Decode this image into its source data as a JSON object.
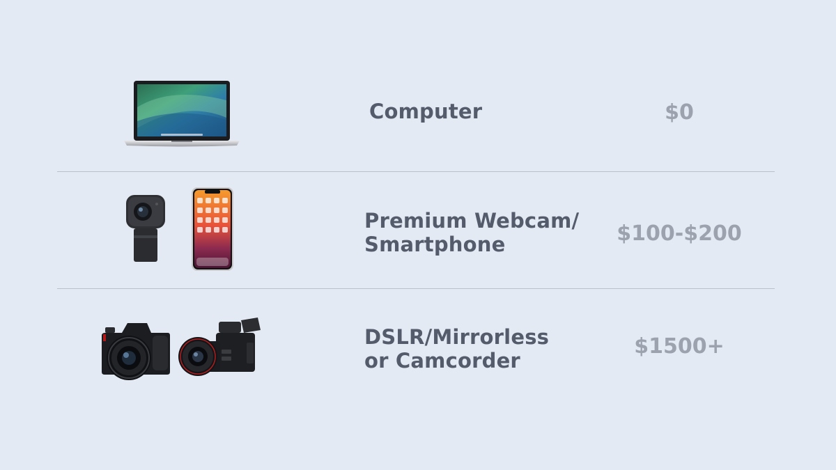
{
  "rows": [
    {
      "id": "computer",
      "label_lines": [
        "Computer"
      ],
      "price": "$0",
      "icon": "laptop-icon"
    },
    {
      "id": "webcam-smartphone",
      "label_lines": [
        "Premium Webcam/",
        "Smartphone"
      ],
      "price": "$100-$200",
      "icons": [
        "webcam-icon",
        "smartphone-icon"
      ]
    },
    {
      "id": "dslr-camcorder",
      "label_lines": [
        "DSLR/Mirrorless",
        "or Camcorder"
      ],
      "price": "$1500+",
      "icons": [
        "dslr-camera-icon",
        "camcorder-icon"
      ]
    }
  ],
  "colors": {
    "background": "#e4eaf4",
    "label": "#545b6b",
    "price": "#9da3ae",
    "divider": "#b9c0cc"
  }
}
